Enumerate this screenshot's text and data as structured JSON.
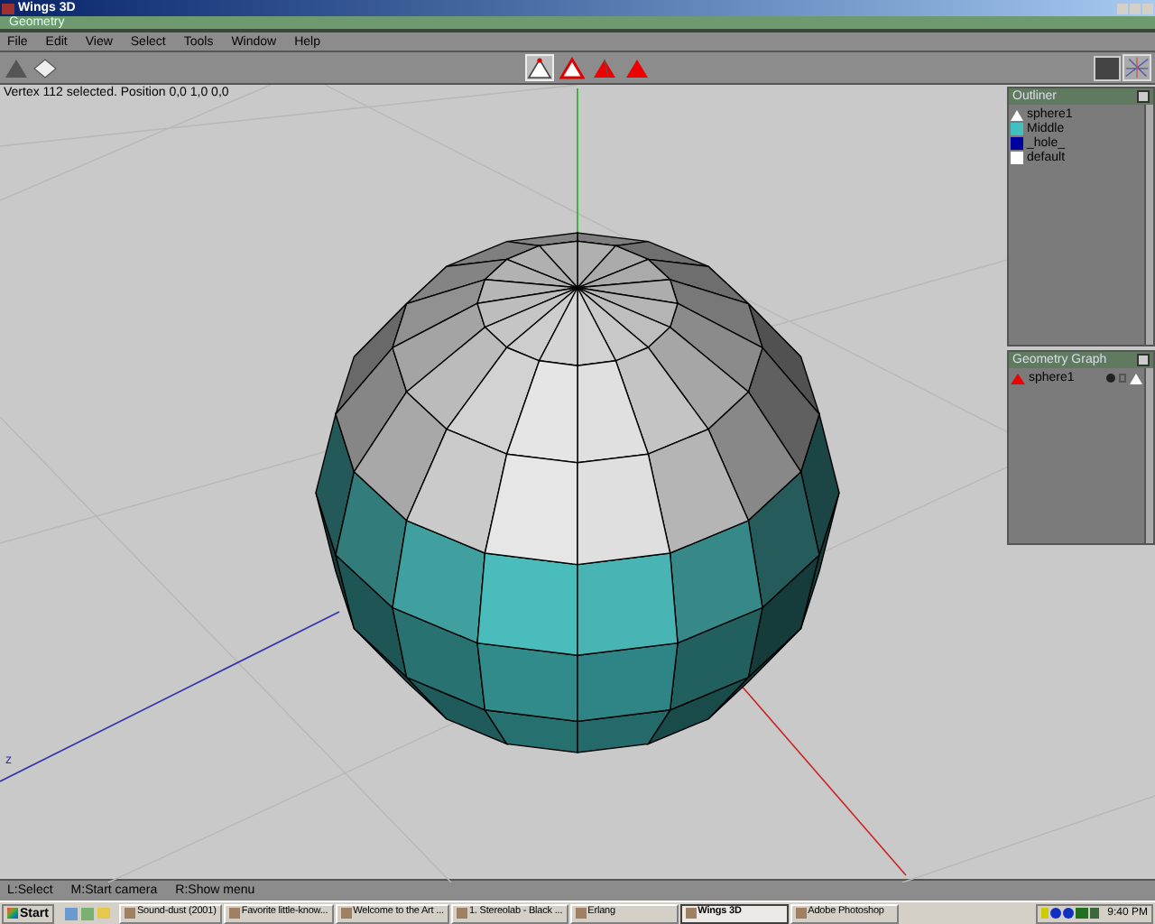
{
  "window": {
    "title": "Wings 3D"
  },
  "geometry_bar": {
    "title": "Geometry"
  },
  "menu": [
    "File",
    "Edit",
    "View",
    "Select",
    "Tools",
    "Window",
    "Help"
  ],
  "selection_modes": [
    {
      "kind": "vertex",
      "selected": true
    },
    {
      "kind": "edge",
      "selected": false
    },
    {
      "kind": "face",
      "selected": false
    },
    {
      "kind": "body",
      "selected": false
    }
  ],
  "info": "Vertex 112 selected. Position 0,0 1,0 0,0",
  "outliner": {
    "title": "Outliner",
    "items": [
      {
        "kind": "object",
        "label": "sphere1"
      },
      {
        "kind": "material",
        "label": "Middle",
        "color": "#40c0c0"
      },
      {
        "kind": "material",
        "label": "_hole_",
        "color": "#0000a0"
      },
      {
        "kind": "material",
        "label": "default",
        "color": "#ffffff"
      }
    ]
  },
  "geometry_graph": {
    "title": "Geometry Graph",
    "items": [
      {
        "label": "sphere1"
      }
    ]
  },
  "axis_label": "z",
  "help_bar": [
    "L:Select",
    "M:Start camera",
    "R:Show menu"
  ],
  "taskbar": {
    "start": "Start",
    "tasks": [
      {
        "label": "Sound-dust (2001)",
        "selected": false
      },
      {
        "label": "Favorite little-know...",
        "selected": false
      },
      {
        "label": "Welcome to the Art ...",
        "selected": false
      },
      {
        "label": "1. Stereolab - Black ...",
        "selected": false
      },
      {
        "label": "Erlang",
        "selected": false
      },
      {
        "label": "Wings 3D",
        "selected": true
      },
      {
        "label": "Adobe Photoshop",
        "selected": false
      }
    ],
    "clock": "9:40 PM"
  }
}
